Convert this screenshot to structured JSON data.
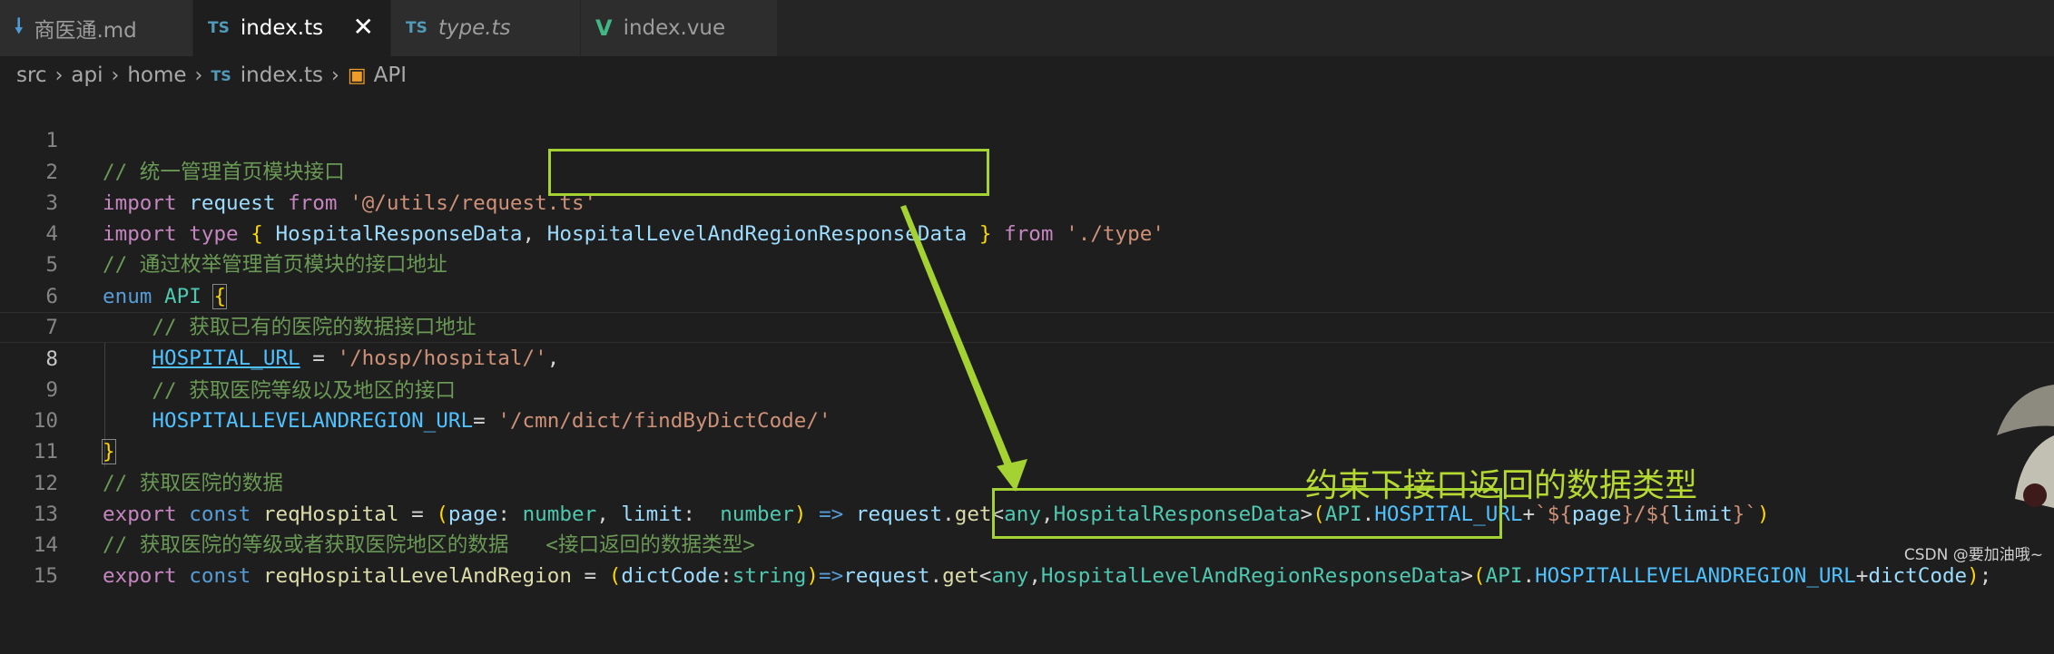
{
  "tabs": [
    {
      "icon": "markdown-icon",
      "glyph": "🠗",
      "label": "商医通.md",
      "italic": false,
      "active": false
    },
    {
      "icon": "typescript-icon",
      "glyph": "TS",
      "label": "index.ts",
      "italic": false,
      "active": true,
      "close": "✕"
    },
    {
      "icon": "typescript-icon",
      "glyph": "TS",
      "label": "type.ts",
      "italic": true,
      "active": false
    },
    {
      "icon": "vue-icon",
      "glyph": "V",
      "label": "index.vue",
      "italic": false,
      "active": false
    }
  ],
  "breadcrumb": {
    "items": [
      "src",
      "api",
      "home",
      "index.ts",
      "API"
    ],
    "ts_glyph": "TS",
    "enum_glyph": "▣"
  },
  "editor": {
    "line_numbers": [
      "1",
      "2",
      "3",
      "4",
      "5",
      "6",
      "7",
      "8",
      "9",
      "10",
      "11",
      "12",
      "13",
      "14",
      "15"
    ],
    "active_line": "8",
    "l1": {
      "comment": "// 统一管理首页模块接口"
    },
    "l2": {
      "import": "import",
      "request": "request",
      "from": "from",
      "path": "'@/utils/request.ts'"
    },
    "l3": {
      "import": "import",
      "type": "type",
      "open": "{",
      "t1": "HospitalResponseData",
      "comma": ",",
      "t2": "HospitalLevelAndRegionResponseData",
      "close": "}",
      "from": "from",
      "path": "'./type'"
    },
    "l4": {
      "comment": "// 通过枚举管理首页模块的接口地址"
    },
    "l5": {
      "enum": "enum",
      "name": "API",
      "open": "{"
    },
    "l6": {
      "comment": "// 获取已有的医院的数据接口地址"
    },
    "l7": {
      "member": "HOSPITAL_URL",
      "eq": " = ",
      "value": "'/hosp/hospital/'",
      "comma": ","
    },
    "l8": {
      "comment": "// 获取医院等级以及地区的接口"
    },
    "l9": {
      "member": "HOSPITALLEVELANDREGION_URL",
      "eq": "= ",
      "value": "'/cmn/dict/findByDictCode/'"
    },
    "l10": {
      "close": "}"
    },
    "l11": {
      "comment": "// 获取医院的数据"
    },
    "l12": {
      "export": "export",
      "const": "const",
      "name": "reqHospital",
      "eq": " = ",
      "p1": "(",
      "page": "page",
      "colon1": ": ",
      "number1": "number",
      "comma1": ", ",
      "limit": "limit",
      "colon2": ":  ",
      "number2": "number",
      "p2": ")",
      "arrow": " => ",
      "request": "request",
      "dot": ".",
      "get": "get",
      "lt": "<",
      "any": "any",
      "comma2": ",",
      "rtype": "HospitalResponseData",
      "gt": ">",
      "p3": "(",
      "api": "API",
      "dot2": ".",
      "member": "HOSPITAL_URL",
      "plus": "+",
      "tpl1": "`${",
      "tv1": "page",
      "tpl2": "}/${",
      "tv2": "limit",
      "tpl3": "}`",
      "p4": ")"
    },
    "l13": {
      "comment": "// 获取医院的等级或者获取医院地区的数据   <接口返回的数据类型>"
    },
    "l14": {
      "export": "export",
      "const": "const",
      "name": "reqHospitalLevelAndRegion",
      "eq": " = ",
      "p1": "(",
      "arg": "dictCode",
      "colon": ":",
      "stype": "string",
      "p2": ")",
      "arrow": "=>",
      "request": "request",
      "dot": ".",
      "get": "get",
      "lt": "<",
      "any": "any",
      "comma": ",",
      "rtype": "HospitalLevelAndRegionResponseData",
      "gt": ">",
      "p3": "(",
      "api": "API",
      "dot2": ".",
      "member": "HOSPITALLEVELANDREGION_URL",
      "plus": "+",
      "arg2": "dictCode",
      "p4": ")",
      "semi": ";"
    }
  },
  "annotation": {
    "text": "约束下接口返回的数据类型",
    "color": "#a4d233"
  },
  "watermark": "CSDN @要加油哦~"
}
